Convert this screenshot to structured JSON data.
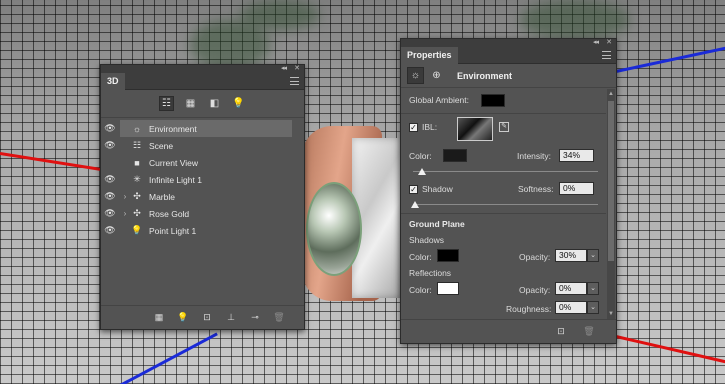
{
  "panel3d": {
    "tab_label": "3D",
    "toolbar": [
      "scene-filter",
      "mesh-filter",
      "material-filter",
      "light-filter"
    ],
    "layers": [
      {
        "label": "Environment",
        "icon": "environment-icon",
        "expandable": false,
        "selected": true
      },
      {
        "label": "Scene",
        "icon": "scene-icon",
        "expandable": false,
        "selected": false
      },
      {
        "label": "Current View",
        "icon": "camera-icon",
        "expandable": false,
        "selected": false
      },
      {
        "label": "Infinite Light 1",
        "icon": "infinite-light-icon",
        "expandable": false,
        "selected": false
      },
      {
        "label": "Marble",
        "icon": "mesh-icon",
        "expandable": true,
        "selected": false
      },
      {
        "label": "Rose Gold",
        "icon": "mesh-icon",
        "expandable": true,
        "selected": false
      },
      {
        "label": "Point Light 1",
        "icon": "point-light-icon",
        "expandable": false,
        "selected": false
      }
    ]
  },
  "properties": {
    "tab_label": "Properties",
    "header_title": "Environment",
    "global_ambient_label": "Global Ambient:",
    "global_ambient_color": "#000000",
    "ibl_label": "IBL:",
    "ibl_checked": true,
    "color_label": "Color:",
    "ibl_color": "#1a1a1a",
    "intensity_label": "Intensity:",
    "intensity_value": "34%",
    "shadow_label": "Shadow",
    "shadow_checked": true,
    "softness_label": "Softness:",
    "softness_value": "0%",
    "ground_plane_label": "Ground Plane",
    "shadows_label": "Shadows",
    "shadows_color_label": "Color:",
    "shadows_color": "#000000",
    "shadows_opacity_label": "Opacity:",
    "shadows_opacity_value": "30%",
    "reflections_label": "Reflections",
    "reflections_color_label": "Color:",
    "reflections_color": "#ffffff",
    "reflections_opacity_label": "Opacity:",
    "reflections_opacity_value": "0%",
    "roughness_label": "Roughness:",
    "roughness_value": "0%"
  },
  "colors": {
    "x_axis": "#e01010",
    "z_axis": "#1a2ad8",
    "panel_bg": "#535353"
  }
}
